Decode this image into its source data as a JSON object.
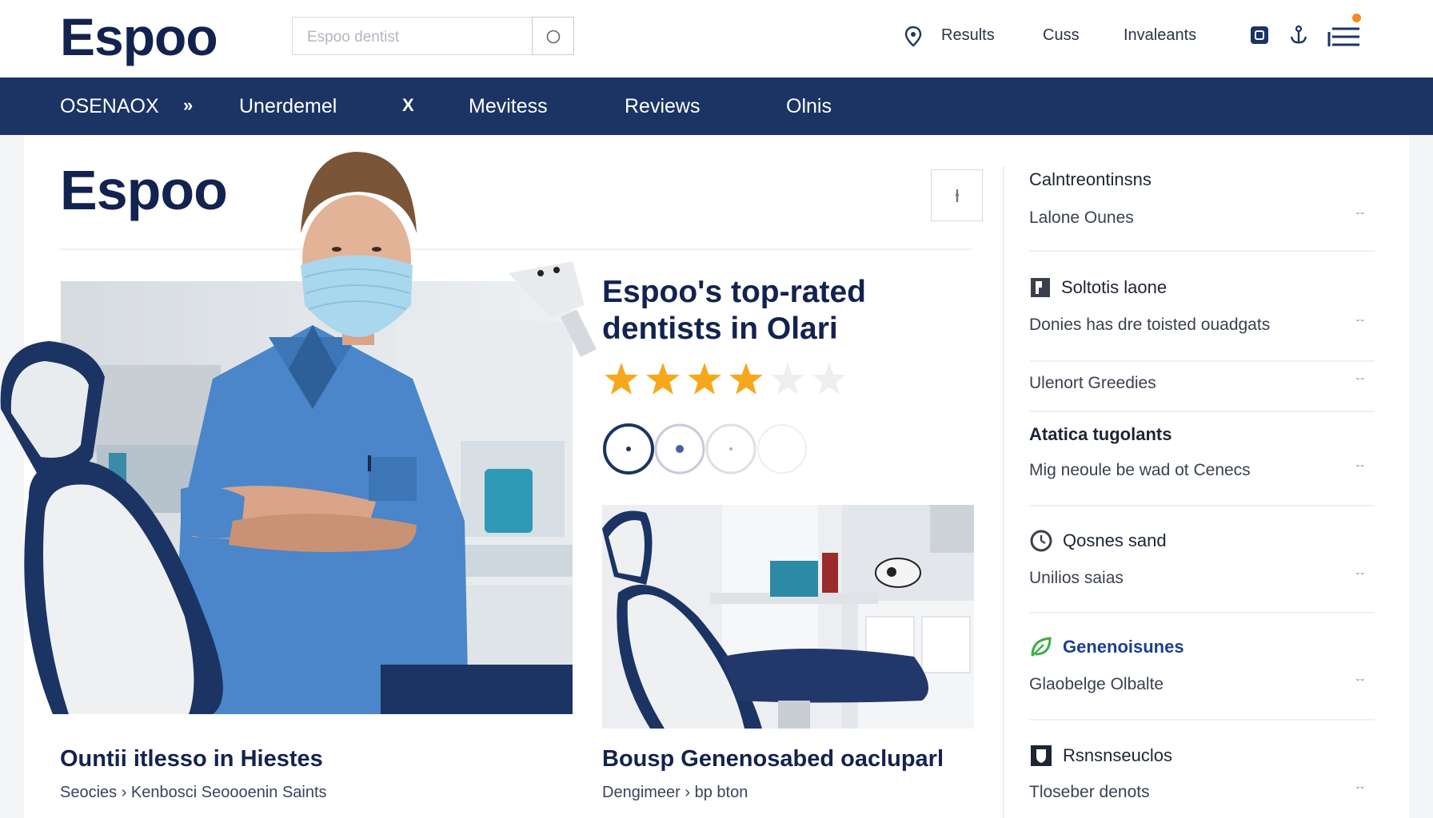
{
  "header": {
    "logo": "Espoo",
    "search_placeholder": "Espoo dentist",
    "nav": [
      "Results",
      "Cuss",
      "Invaleants"
    ],
    "icons": [
      "location-pin-icon",
      "app-icon",
      "anchor-icon",
      "menu-icon"
    ]
  },
  "navbar": {
    "items": [
      "OSENAOX",
      "Unerdemel",
      "Mevitess",
      "Reviews",
      "Olnis"
    ],
    "separators": [
      "»",
      "X"
    ]
  },
  "page": {
    "title": "Espoo"
  },
  "hero_card": {
    "title": "Ountii itlesso in Hiestes",
    "meta": "Seocies › Kenbosci Seoooenin Saints"
  },
  "feature": {
    "heading": "Espoo's top-rated dentists in Olari",
    "rating": 4,
    "rating_max": 6
  },
  "second_card": {
    "title": "Bousp Genenosabed oacluparl",
    "meta": "Dengimeer › bp bton"
  },
  "sidebar": {
    "sections": [
      {
        "heading": "Calntreontinsns",
        "icon": "",
        "items": [
          "Lalone Ounes"
        ]
      },
      {
        "heading": "Soltotis laone",
        "icon": "square-icon",
        "items": [
          "Donies has dre toisted ouadgats",
          "Ulenort Greedies"
        ]
      },
      {
        "heading": "Atatica tugolants",
        "icon": "",
        "items": [
          "Mig neoule be wad ot Cenecs"
        ]
      },
      {
        "heading": "Qosnes sand",
        "icon": "clock-icon",
        "items": [
          "Unilios saias"
        ]
      },
      {
        "heading": "Genenoisunes",
        "icon": "leaf-icon",
        "items": [
          "Glaobelge Olbalte"
        ]
      },
      {
        "heading": "Rsnsnseuclos",
        "icon": "shield-icon",
        "items": [
          "Tloseber denots"
        ]
      }
    ],
    "chevron": "ˇˇ"
  },
  "colors": {
    "navy": "#1b3464",
    "brand_dark": "#13234f",
    "star": "#f6a81b",
    "star_off": "#eeeeee",
    "accent": "#f08a24"
  }
}
